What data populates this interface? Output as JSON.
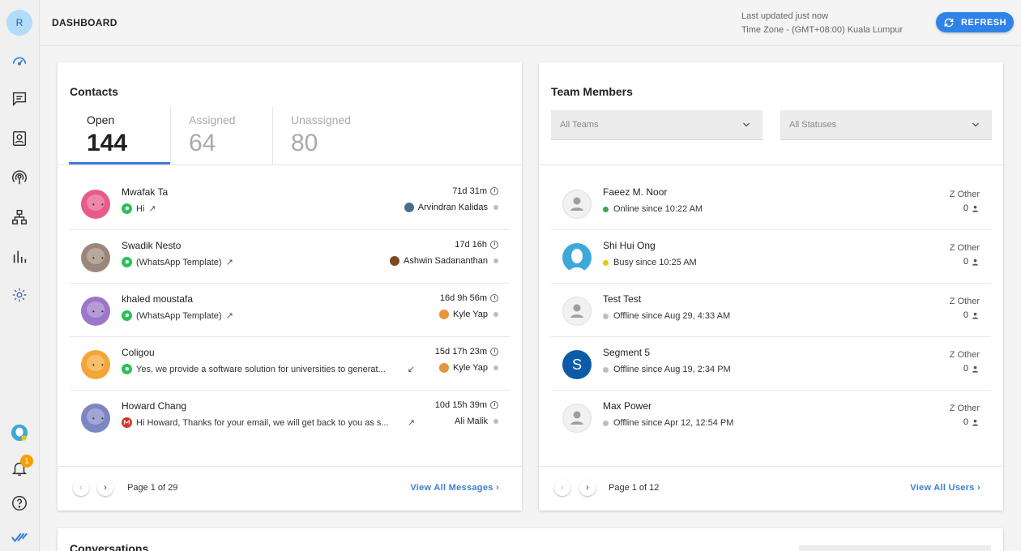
{
  "sidebar": {
    "avatar_initial": "R",
    "notification_count": "1"
  },
  "header": {
    "title": "DASHBOARD",
    "last_updated": "Last updated just now",
    "timezone": "Time Zone - (GMT+08:00) Kuala Lumpur",
    "refresh_label": "REFRESH"
  },
  "contacts": {
    "title": "Contacts",
    "tabs": [
      {
        "label": "Open",
        "count": "144"
      },
      {
        "label": "Assigned",
        "count": "64"
      },
      {
        "label": "Unassigned",
        "count": "80"
      }
    ],
    "rows": [
      {
        "name": "Mwafak Ta",
        "message": "Hi",
        "time": "71d 31m",
        "assignee": "Arvindran Kalidas",
        "channel": "whatsapp"
      },
      {
        "name": "Swadik Nesto",
        "message": "(WhatsApp Template)",
        "time": "17d 16h",
        "assignee": "Ashwin Sadananthan",
        "channel": "whatsapp"
      },
      {
        "name": "khaled moustafa",
        "message": "(WhatsApp Template)",
        "time": "16d 9h 56m",
        "assignee": "Kyle Yap",
        "channel": "whatsapp"
      },
      {
        "name": "Coligou",
        "message": "Yes, we provide a software solution for universities to generat...",
        "time": "15d 17h 23m",
        "assignee": "Kyle Yap",
        "channel": "whatsapp"
      },
      {
        "name": "Howard Chang",
        "message": "Hi Howard, Thanks for your email, we will get back to you as s...",
        "time": "10d 15h 39m",
        "assignee": "Ali Malik",
        "channel": "email"
      }
    ],
    "page_text": "Page 1 of 29",
    "view_all": "View All Messages"
  },
  "team": {
    "title": "Team Members",
    "teams_placeholder": "All Teams",
    "statuses_placeholder": "All Statuses",
    "members": [
      {
        "name": "Faeez M. Noor",
        "status": "Online since 10:22 AM",
        "status_color": "#2eaa4f",
        "team": "Z Other",
        "count": "0"
      },
      {
        "name": "Shi Hui Ong",
        "status": "Busy since 10:25 AM",
        "status_color": "#f2c40f",
        "team": "Z Other",
        "count": "0"
      },
      {
        "name": "Test Test",
        "status": "Offline since Aug 29, 4:33 AM",
        "status_color": "#bdbdbd",
        "team": "Z Other",
        "count": "0"
      },
      {
        "name": "Segment 5",
        "initial": "S",
        "status": "Offline since Aug 19, 2:34 PM",
        "status_color": "#bdbdbd",
        "team": "Z Other",
        "count": "0"
      },
      {
        "name": "Max Power",
        "status": "Offline since Apr 12, 12:54 PM",
        "status_color": "#bdbdbd",
        "team": "Z Other",
        "count": "0"
      }
    ],
    "page_text": "Page 1 of 12",
    "view_all": "View All Users"
  },
  "conversations": {
    "title": "Conversations"
  },
  "colors": {
    "accent": "#2f82e8",
    "tab_underline": "#3f7ed8",
    "link": "#3a7fd0"
  }
}
